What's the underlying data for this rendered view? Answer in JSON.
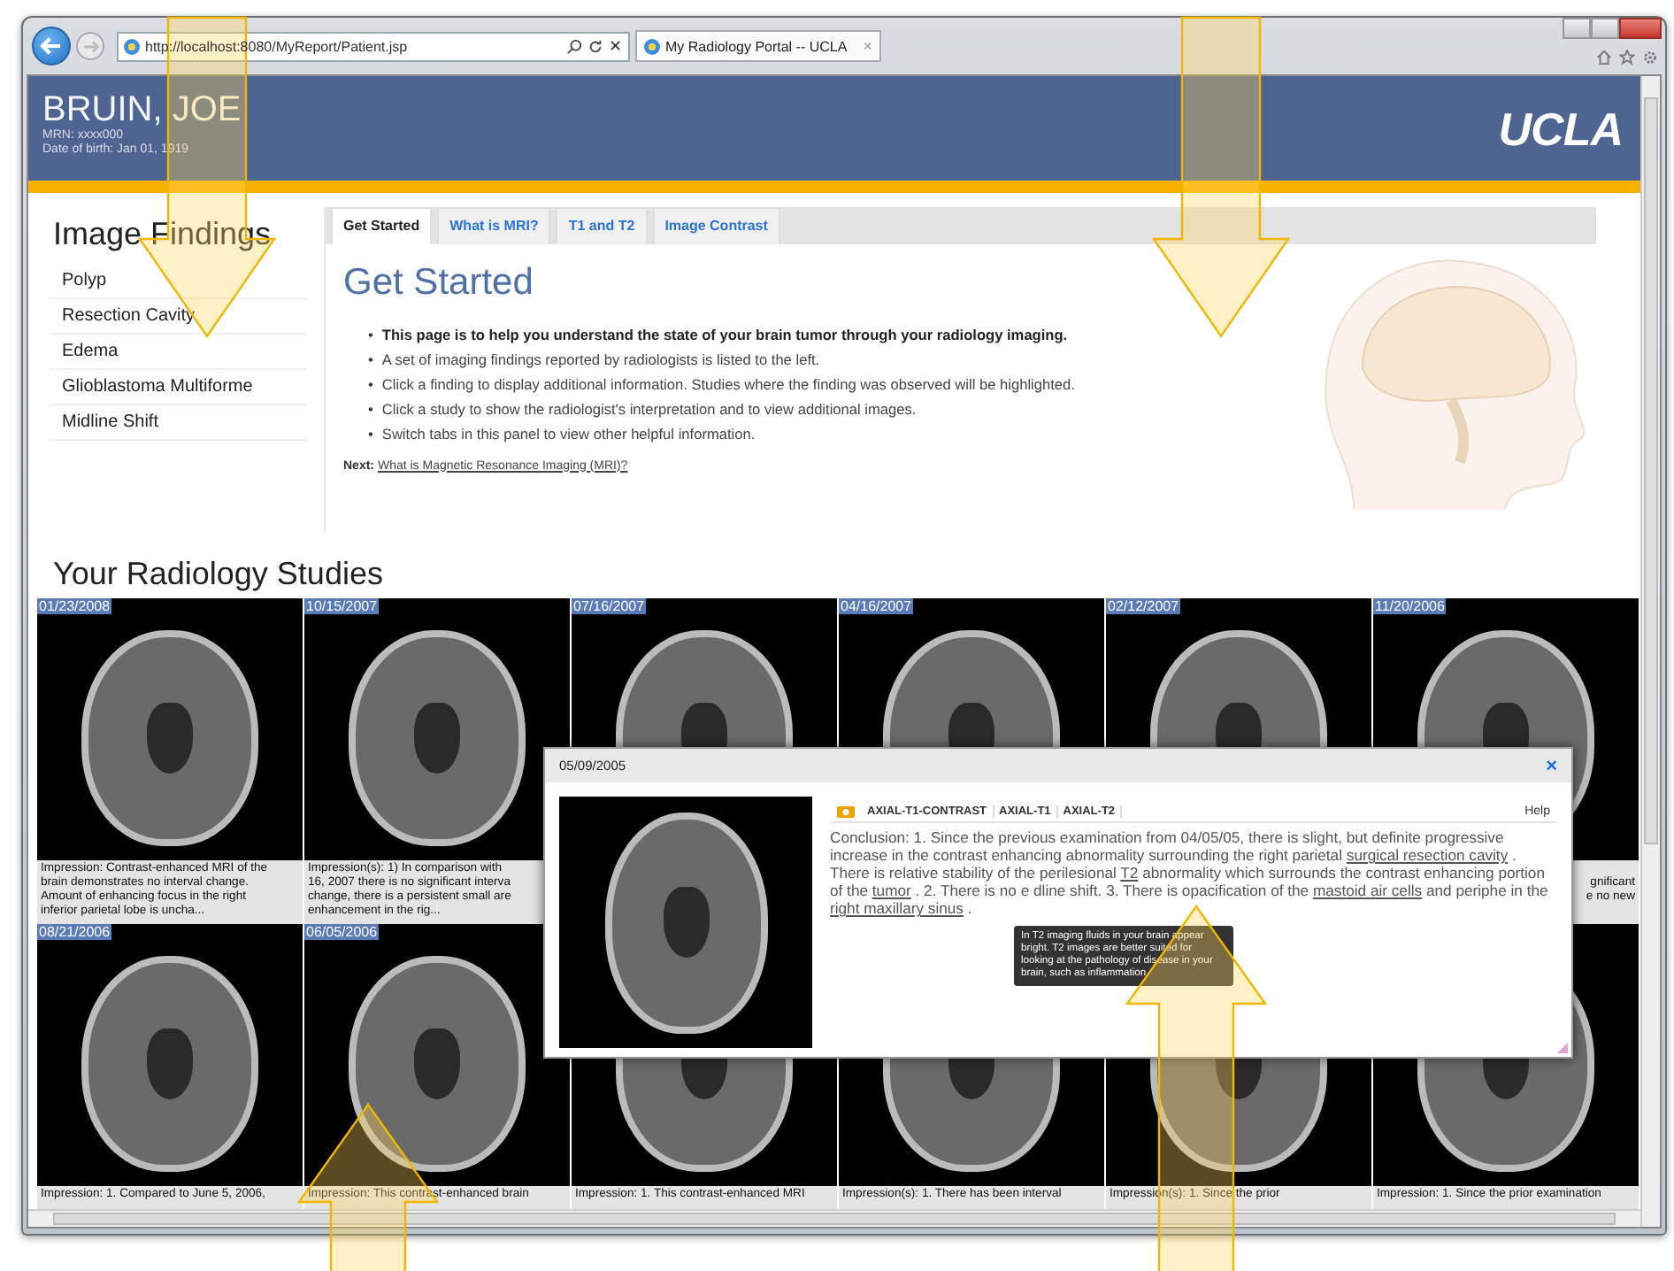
{
  "browser": {
    "address": "http://localhost:8080/MyReport/Patient.jsp",
    "tab_title": "My Radiology Portal -- UCLA",
    "tab_close": "×",
    "stop": "✕"
  },
  "header": {
    "patient_name": "BRUIN, JOE",
    "mrn": "MRN: xxxx000",
    "birth_date": "Date of birth: Jan 01, 1919",
    "logo": "UCLA"
  },
  "findings": {
    "title": "Image Findings",
    "items": [
      "Polyp",
      "Resection Cavity",
      "Edema",
      "Glioblastoma Multiforme",
      "Midline Shift"
    ]
  },
  "info_panel": {
    "tabs": [
      {
        "label": "Get Started",
        "selected": true
      },
      {
        "label": "What is MRI?",
        "selected": false
      },
      {
        "label": "T1 and T2",
        "selected": false
      },
      {
        "label": "Image Contrast",
        "selected": false
      }
    ],
    "heading": "Get Started",
    "bullets": [
      {
        "marker": "•",
        "text": "This page is to help you understand the state of your brain tumor through your radiology imaging.",
        "bold": true
      },
      {
        "marker": "•",
        "text": "A set of imaging findings reported by radiologists is listed to the left.",
        "bold": false
      },
      {
        "marker": "•",
        "text": "Click a finding to display additional information. Studies where the finding was observed will be highlighted.",
        "bold": false
      },
      {
        "marker": "•",
        "text": "Click a study to show the radiologist's interpretation and to view additional images.",
        "bold": false
      },
      {
        "marker": "•",
        "text": "Switch tabs in this panel to view other helpful information.",
        "bold": false
      }
    ],
    "next_label": "Next:",
    "next_link": "What is Magnetic Resonance Imaging (MRI)?"
  },
  "studies": {
    "title": "Your Radiology Studies",
    "items": [
      {
        "date": "01/23/2008",
        "caption": [
          "Impression: Contrast-enhanced MRI of the",
          "brain demonstrates no interval change.",
          "Amount of enhancing focus in the right",
          "inferior parietal lobe is uncha..."
        ]
      },
      {
        "date": "10/15/2007",
        "caption": [
          "Impression(s): 1) In comparison with",
          "16, 2007 there is no significant interva",
          "change, there is a persistent small are",
          "enhancement in the rig..."
        ]
      },
      {
        "date": "07/16/2007"
      },
      {
        "date": "04/16/2007"
      },
      {
        "date": "02/12/2007"
      },
      {
        "date": "11/20/2006",
        "caption": [
          "gnificant",
          "e no new"
        ]
      },
      {
        "date": "08/21/2006",
        "caption": [
          "Impression: 1. Compared to June 5, 2006,"
        ]
      },
      {
        "date": "06/05/2006",
        "caption": [
          "Impression: This contrast-enhanced brain"
        ]
      },
      {
        "caption": [
          "Impression: 1. This contrast-enhanced MRI"
        ]
      },
      {
        "caption": [
          "Impression(s): 1. There has been interval"
        ]
      },
      {
        "caption": [
          "Impression(s): 1. Since the prior"
        ]
      },
      {
        "caption": [
          "Impression: 1. Since the prior examination"
        ]
      }
    ]
  },
  "study_popup": {
    "date": "05/09/2005",
    "close": "×",
    "tabs": [
      "AXIAL-T1-CONTRAST",
      "AXIAL-T1",
      "AXIAL-T2"
    ],
    "help": "Help",
    "conclusion": [
      {
        "text": "Conclusion: 1. Since the previous examination from 04/05/05, there is slight, but definite progressive increase in the contrast enhancing abnormality surrounding the right parietal",
        "link": false
      },
      {
        "text": "surgical resection cavity",
        "link": true
      },
      {
        "text": ". There is relative stability of the perilesional",
        "link": false
      },
      {
        "text": "T2",
        "link": true
      },
      {
        "text": "abnormality which surrounds the contrast enhancing portion of the",
        "link": false
      },
      {
        "text": "tumor",
        "link": true
      },
      {
        "text": ". 2. There is no e",
        "link": false
      },
      {
        "text": "dline shift. 3. There is opacification of the",
        "link": false
      },
      {
        "text": "mastoid air cells",
        "link": true
      },
      {
        "text": "and periphe",
        "link": false
      },
      {
        "text": "in the",
        "link": false
      },
      {
        "text": "right maxillary sinus",
        "link": true
      },
      {
        "text": ".",
        "link": false
      }
    ],
    "tooltip": "In T2 imaging fluids in your brain appear bright. T2 images are better suited for looking at the pathology of disease in your brain, such as inflammation."
  }
}
